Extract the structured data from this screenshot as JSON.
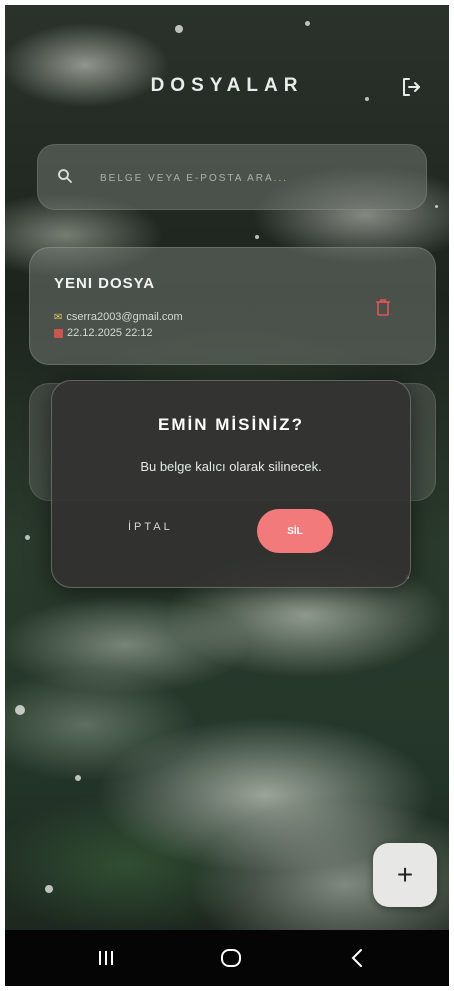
{
  "header": {
    "title": "DOSYALAR",
    "logout_icon": "logout-icon"
  },
  "search": {
    "placeholder": "BELGE VEYA E-POSTA ARA...",
    "icon": "search-icon"
  },
  "documents": [
    {
      "title": "YENI DOSYA",
      "email": "cserra2003@gmail.com",
      "date": "22.12.2025 22:12",
      "delete_icon": "trash-icon"
    }
  ],
  "dialog": {
    "title": "EMİN MİSİNİZ?",
    "message": "Bu belge kalıcı olarak silinecek.",
    "cancel_label": "İPTAL",
    "confirm_label": "SİL"
  },
  "fab": {
    "label": "+"
  },
  "colors": {
    "accent_delete": "#f27a7a",
    "trash": "#e05555"
  },
  "navigation": {
    "icons": [
      "recents-icon",
      "home-icon",
      "back-icon"
    ]
  }
}
